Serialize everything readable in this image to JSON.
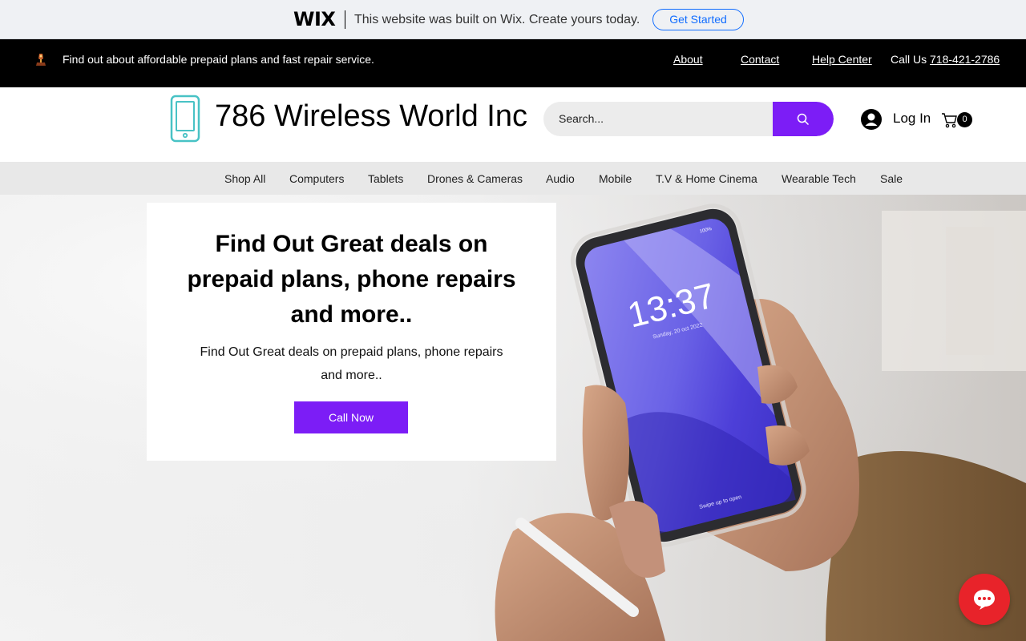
{
  "wix_banner": {
    "logo": "WIX",
    "message": "This website was built on Wix. Create yours today.",
    "cta": "Get Started"
  },
  "topbar": {
    "message": "Find out about affordable prepaid plans and fast repair service.",
    "links": [
      "About",
      "Contact",
      "Help Center"
    ],
    "call_label": "Call Us ",
    "phone": "718-421-2786"
  },
  "header": {
    "brand": "786 Wireless World Inc",
    "search_placeholder": "Search...",
    "login_label": "Log In",
    "cart_count": "0"
  },
  "nav": {
    "items": [
      "Shop All",
      "Computers",
      "Tablets",
      "Drones & Cameras",
      "Audio",
      "Mobile",
      "T.V & Home Cinema",
      "Wearable Tech",
      "Sale"
    ]
  },
  "hero": {
    "title": "Find Out Great deals on prepaid plans, phone repairs and more..",
    "subtitle": "Find Out Great deals on prepaid plans, phone repairs and more..",
    "cta": "Call Now",
    "phone_clock": "13:37",
    "phone_date": "Sunday, 20 oct 2022",
    "phone_swipe": "Swipe up to open",
    "phone_battery": "100%"
  },
  "colors": {
    "accent": "#7c1df6",
    "wix_blue": "#116dff",
    "chat_red": "#e8232a"
  },
  "icons": [
    "trophy-icon",
    "phone-logo-icon",
    "search-icon",
    "user-icon",
    "cart-icon",
    "chat-icon"
  ]
}
